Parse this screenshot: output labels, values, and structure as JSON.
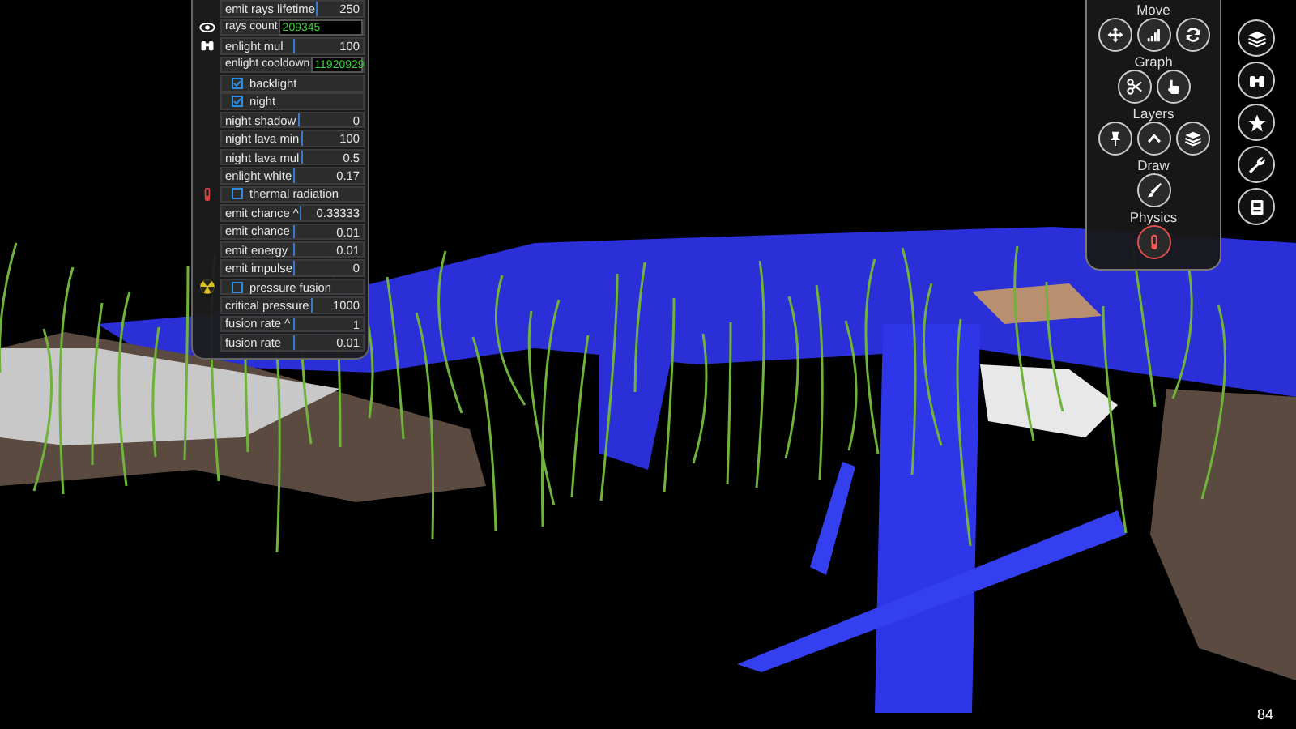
{
  "settings_panel": {
    "rows": [
      {
        "kind": "slider",
        "label": "emit rays lifetime",
        "value": "250"
      },
      {
        "kind": "field",
        "label": "rays count",
        "value": "209345"
      },
      {
        "kind": "slider",
        "label": "enlight mul",
        "value": "100"
      },
      {
        "kind": "field",
        "label": "enlight cooldown",
        "value": "11920929"
      },
      {
        "kind": "checkbox",
        "label": "backlight",
        "checked": true
      },
      {
        "kind": "checkbox",
        "label": "night",
        "checked": true
      },
      {
        "kind": "slider",
        "label": "night shadow",
        "value": "0"
      },
      {
        "kind": "slider",
        "label": "night lava min",
        "value": "100"
      },
      {
        "kind": "slider",
        "label": "night lava mul",
        "value": "0.5"
      },
      {
        "kind": "slider",
        "label": "enlight white",
        "value": "0.17"
      },
      {
        "kind": "checkbox",
        "label": "thermal radiation",
        "checked": false
      },
      {
        "kind": "slider",
        "label": "emit chance ^",
        "value": "0.33333"
      },
      {
        "kind": "slider",
        "label": "emit chance",
        "value": "0.01"
      },
      {
        "kind": "slider",
        "label": "emit energy",
        "value": "0.01"
      },
      {
        "kind": "slider",
        "label": "emit impulse",
        "value": "0"
      },
      {
        "kind": "checkbox",
        "label": "pressure fusion",
        "checked": false
      },
      {
        "kind": "slider",
        "label": "critical pressure",
        "value": "1000"
      },
      {
        "kind": "slider",
        "label": "fusion rate ^",
        "value": "1"
      },
      {
        "kind": "slider",
        "label": "fusion rate",
        "value": "0.01"
      }
    ]
  },
  "tool_panel": {
    "groups": [
      {
        "title": "Move",
        "buttons": [
          {
            "active": false
          },
          {
            "active": false
          },
          {
            "active": false
          }
        ]
      },
      {
        "title": "Graph",
        "buttons": [
          {
            "active": false
          },
          {
            "active": false
          }
        ]
      },
      {
        "title": "Layers",
        "buttons": [
          {
            "active": false
          },
          {
            "active": false
          },
          {
            "active": false
          }
        ]
      },
      {
        "title": "Draw",
        "buttons": [
          {
            "active": false
          }
        ]
      },
      {
        "title": "Physics",
        "buttons": [
          {
            "active": true
          }
        ]
      }
    ]
  },
  "fps": "84"
}
